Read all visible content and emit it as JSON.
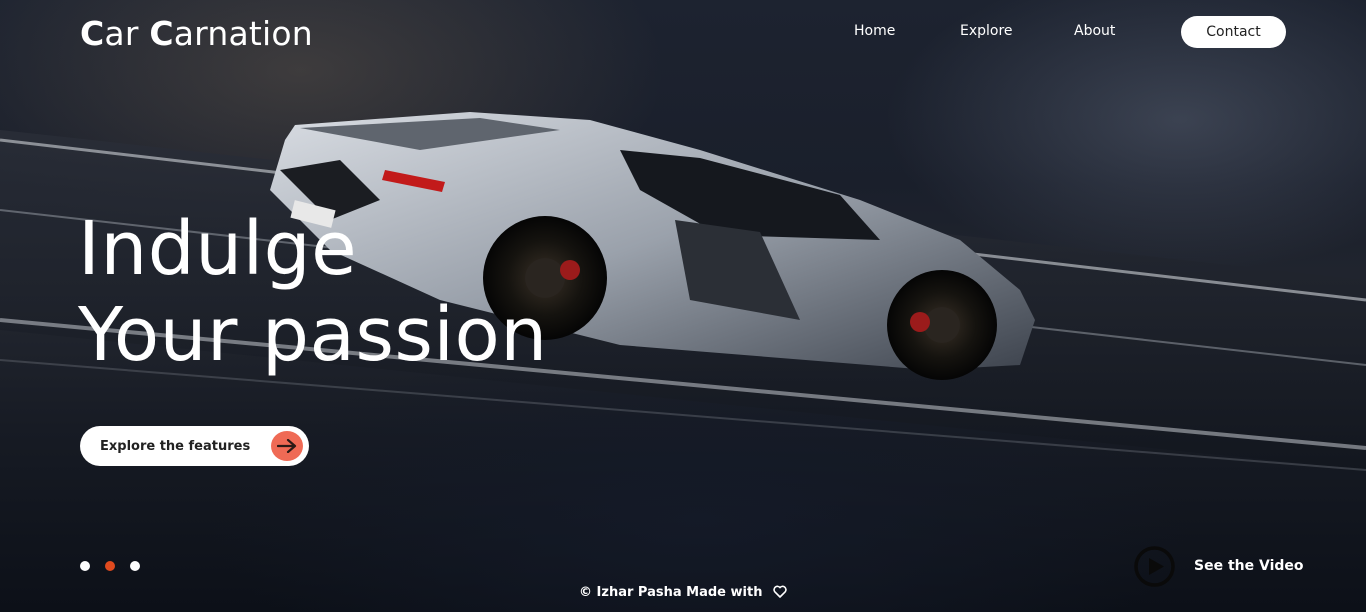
{
  "brand": {
    "logo_prefix": "C",
    "logo_word1": "ar ",
    "logo_prefix2": "C",
    "logo_word2": "arnation"
  },
  "nav": {
    "items": [
      {
        "label": "Home"
      },
      {
        "label": "Explore"
      },
      {
        "label": "About"
      }
    ],
    "contact_label": "Contact"
  },
  "hero": {
    "line1": "Indulge",
    "line2": "Your passion"
  },
  "cta": {
    "label": "Explore the features",
    "icon": "arrow-right-icon",
    "icon_color": "#ef6a55"
  },
  "slider": {
    "count": 3,
    "active": 2,
    "active_color": "#e04a1e"
  },
  "video": {
    "label": "See the Video",
    "icon": "play-icon"
  },
  "footer": {
    "text": "© Izhar Pasha Made with",
    "icon": "heart-icon"
  }
}
